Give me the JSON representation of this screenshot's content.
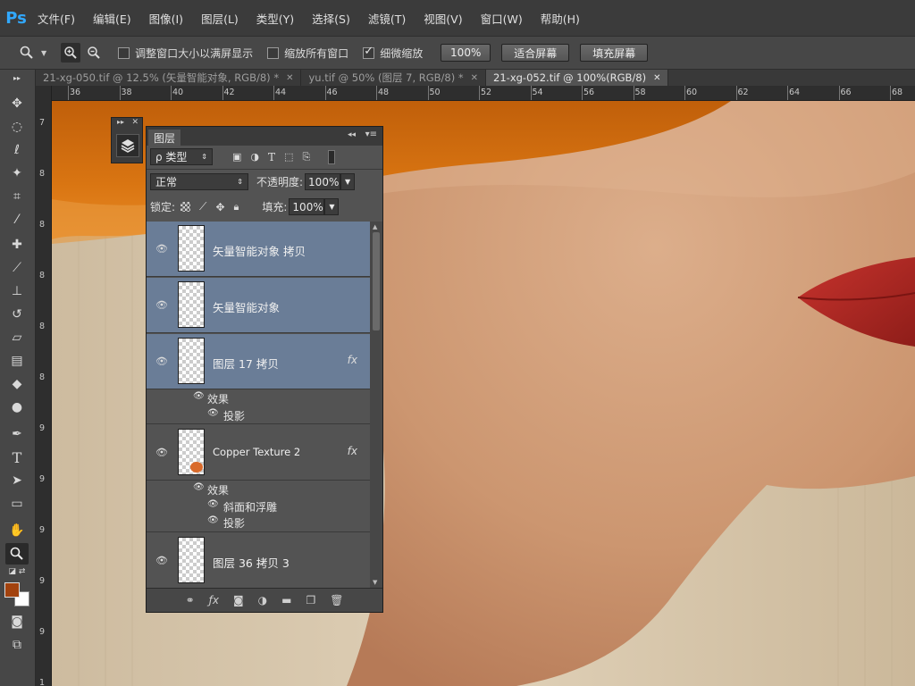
{
  "app_logo": "Ps",
  "menu": [
    "文件(F)",
    "编辑(E)",
    "图像(I)",
    "图层(L)",
    "类型(Y)",
    "选择(S)",
    "滤镜(T)",
    "视图(V)",
    "窗口(W)",
    "帮助(H)"
  ],
  "options": {
    "resize_windows": "调整窗口大小以满屏显示",
    "zoom_all": "缩放所有窗口",
    "scrubby_zoom": "细微缩放",
    "zoom_pct": "100%",
    "fit_screen": "适合屏幕",
    "fill_screen": "填充屏幕"
  },
  "tabs": [
    {
      "label": "21-xg-050.tif @ 12.5% (矢量智能对象, RGB/8) *"
    },
    {
      "label": "yu.tif @ 50% (图层 7, RGB/8) *"
    },
    {
      "label": "21-xg-052.tif @ 100%(RGB/8)"
    }
  ],
  "ruler": {
    "h": [
      "36",
      "38",
      "40",
      "42",
      "44",
      "46",
      "48",
      "50",
      "52",
      "54",
      "56",
      "58",
      "60",
      "62",
      "64",
      "66",
      "68"
    ],
    "v": [
      "7",
      "8",
      "8",
      "8",
      "8",
      "8",
      "9",
      "9",
      "9",
      "9",
      "9",
      "1"
    ]
  },
  "layers_panel": {
    "title": "图层",
    "filter_kind": "ρ 类型",
    "blend_mode": "正常",
    "opacity_label": "不透明度:",
    "opacity_value": "100%",
    "lock_label": "锁定:",
    "fill_label": "填充:",
    "fill_value": "100%",
    "layers": [
      {
        "name": "矢量智能对象 拷贝"
      },
      {
        "name": "矢量智能对象"
      },
      {
        "name": "图层 17 拷贝",
        "fx": "fx",
        "effects_label": "效果",
        "effects": [
          "投影"
        ]
      },
      {
        "name": "Copper Texture 2",
        "fx": "fx",
        "effects_label": "效果",
        "effects": [
          "斜面和浮雕",
          "投影"
        ]
      },
      {
        "name": "图层 36 拷贝 3"
      }
    ]
  },
  "colors": {
    "foreground": "#a2420e",
    "background": "#ffffff",
    "selection": "#6a7d97",
    "hat": "#d4700f",
    "skin": "#d4a07a"
  }
}
